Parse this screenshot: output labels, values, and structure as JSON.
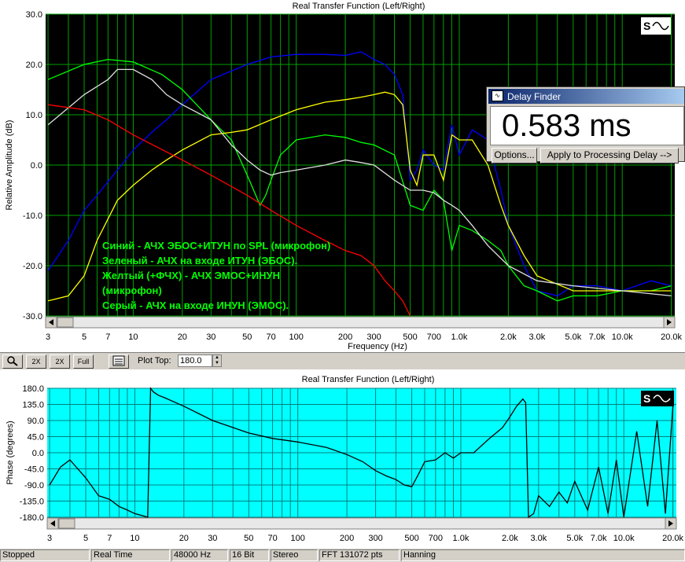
{
  "colors": {
    "magnitude_bg": "#000000",
    "phase_bg": "#00ffff",
    "grid_green": "#00a000",
    "phase_grid": "#008080",
    "annotation_text": "#00ff00",
    "series_blue": "#0000ff",
    "series_green": "#00ff00",
    "series_yellow": "#ffff00",
    "series_gray": "#e0e0e0",
    "series_red": "#ff0000"
  },
  "magnitude_chart": {
    "title": "Real Transfer Function (Left/Right)",
    "ylabel": "Relative Amplitude (dB)",
    "xlabel": "Frequency (Hz)",
    "y_ticks": [
      "30.0",
      "20.0",
      "10.0",
      "0.0",
      "-10.0",
      "-20.0",
      "-30.0"
    ],
    "x_ticks": [
      {
        "label": "3",
        "f": 3
      },
      {
        "label": "5",
        "f": 5
      },
      {
        "label": "7",
        "f": 7
      },
      {
        "label": "10",
        "f": 10
      },
      {
        "label": "20",
        "f": 20
      },
      {
        "label": "30",
        "f": 30
      },
      {
        "label": "50",
        "f": 50
      },
      {
        "label": "70",
        "f": 70
      },
      {
        "label": "100",
        "f": 100
      },
      {
        "label": "200",
        "f": 200
      },
      {
        "label": "300",
        "f": 300
      },
      {
        "label": "500",
        "f": 500
      },
      {
        "label": "700",
        "f": 700
      },
      {
        "label": "1.0k",
        "f": 1000
      },
      {
        "label": "2.0k",
        "f": 2000
      },
      {
        "label": "3.0k",
        "f": 3000
      },
      {
        "label": "5.0k",
        "f": 5000
      },
      {
        "label": "7.0k",
        "f": 7000
      },
      {
        "label": "10.0k",
        "f": 10000
      },
      {
        "label": "20.0k",
        "f": 20000
      }
    ],
    "annotation_lines": [
      "Синий - АЧХ ЭБОС+ИТУН по SPL (микрофон)",
      "Зеленый - АЧХ на входе ИТУН (ЭБОС).",
      "Желтый (+ФЧХ) - АЧХ ЭМОС+ИНУН",
      "(микрофон)",
      "Серый - АЧХ на входе ИНУН (ЭМОС)."
    ]
  },
  "phase_chart": {
    "title": "Real Transfer Function (Left/Right)",
    "ylabel": "Phase (degrees)",
    "xlabel": "Frequency (Hz)",
    "y_ticks": [
      "180.0",
      "135.0",
      "90.0",
      "45.0",
      "0.0",
      "-45.0",
      "-90.0",
      "-135.0",
      "-180.0"
    ],
    "x_ticks": [
      {
        "label": "3",
        "f": 3
      },
      {
        "label": "5",
        "f": 5
      },
      {
        "label": "7",
        "f": 7
      },
      {
        "label": "10",
        "f": 10
      },
      {
        "label": "20",
        "f": 20
      },
      {
        "label": "30",
        "f": 30
      },
      {
        "label": "50",
        "f": 50
      },
      {
        "label": "70",
        "f": 70
      },
      {
        "label": "100",
        "f": 100
      },
      {
        "label": "200",
        "f": 200
      },
      {
        "label": "300",
        "f": 300
      },
      {
        "label": "500",
        "f": 500
      },
      {
        "label": "700",
        "f": 700
      },
      {
        "label": "1.0k",
        "f": 1000
      },
      {
        "label": "2.0k",
        "f": 2000
      },
      {
        "label": "3.0k",
        "f": 3000
      },
      {
        "label": "5.0k",
        "f": 5000
      },
      {
        "label": "7.0k",
        "f": 7000
      },
      {
        "label": "10.0k",
        "f": 10000
      },
      {
        "label": "20.0k",
        "f": 20000
      }
    ]
  },
  "chart_data": [
    {
      "type": "line",
      "title": "Real Transfer Function (Left/Right)",
      "xlabel": "Frequency (Hz)",
      "ylabel": "Relative Amplitude (dB)",
      "x_scale": "log",
      "xlim": [
        2.9,
        21000
      ],
      "ylim": [
        -30,
        30
      ],
      "grid": true,
      "legend": "none",
      "series": [
        {
          "color": "#0000ff",
          "x": [
            3,
            4,
            5,
            6,
            8,
            10,
            13,
            16,
            20,
            30,
            50,
            70,
            100,
            150,
            200,
            250,
            300,
            350,
            400,
            450,
            500,
            550,
            600,
            700,
            800,
            900,
            1000,
            1200,
            1500,
            1800,
            2000,
            2500,
            3000,
            4000,
            5000,
            7000,
            10000,
            15000,
            20000
          ],
          "y": [
            -21,
            -15,
            -9,
            -6,
            -1,
            3,
            6.5,
            9,
            12,
            17,
            20,
            21.5,
            22,
            22,
            21.8,
            22.5,
            21,
            20,
            18,
            14,
            -3,
            -1,
            3,
            0,
            -1,
            8,
            2,
            7,
            5,
            -5,
            -12,
            -20,
            -25,
            -26,
            -24,
            -24,
            -25,
            -23,
            -24
          ]
        },
        {
          "color": "#00ff00",
          "x": [
            3,
            5,
            7,
            10,
            15,
            20,
            30,
            40,
            50,
            60,
            65,
            70,
            80,
            100,
            150,
            200,
            250,
            300,
            400,
            500,
            600,
            700,
            800,
            900,
            1000,
            1200,
            1500,
            1800,
            2000,
            2500,
            3000,
            4000,
            5000,
            7000,
            10000,
            15000,
            20000
          ],
          "y": [
            17,
            20,
            21,
            20.5,
            18,
            15,
            9,
            5,
            -2,
            -8,
            -6,
            -3,
            2,
            5,
            6,
            5.5,
            4.5,
            4,
            2,
            -8,
            -9,
            -5,
            -7,
            -17,
            -12,
            -13,
            -15,
            -17,
            -20,
            -24,
            -25,
            -27,
            -26,
            -26,
            -25,
            -25,
            -24
          ]
        },
        {
          "color": "#ffff00",
          "x": [
            3,
            4,
            5,
            6,
            8,
            10,
            13,
            16,
            20,
            30,
            40,
            50,
            70,
            100,
            150,
            200,
            250,
            300,
            350,
            400,
            450,
            500,
            550,
            600,
            700,
            800,
            900,
            1000,
            1200,
            1500,
            1800,
            2000,
            2500,
            3000,
            5000,
            10000,
            15000,
            20000
          ],
          "y": [
            -27,
            -26,
            -22,
            -15,
            -7,
            -4,
            -1,
            1,
            3,
            6,
            6.5,
            7,
            9,
            11,
            12.5,
            13,
            13.5,
            14,
            14.5,
            14,
            12,
            -1,
            -4,
            2,
            2,
            -3,
            6,
            5,
            5,
            0,
            -8,
            -12,
            -18,
            -22,
            -25,
            -25,
            -25,
            -25
          ]
        },
        {
          "color": "#e0e0e0",
          "x": [
            3,
            5,
            7,
            8,
            10,
            13,
            16,
            20,
            30,
            40,
            50,
            60,
            70,
            80,
            100,
            150,
            200,
            250,
            300,
            400,
            500,
            600,
            700,
            800,
            900,
            1000,
            1200,
            1500,
            2000,
            3000,
            5000,
            10000,
            20000
          ],
          "y": [
            8,
            14,
            17,
            19,
            19,
            17,
            14,
            12,
            9,
            4,
            1,
            -1,
            -2,
            -1.5,
            -1,
            0,
            1,
            0.5,
            0,
            -3,
            -5,
            -5,
            -5.5,
            -7,
            -8,
            -9,
            -12,
            -16,
            -20,
            -23,
            -24,
            -25,
            -26
          ]
        },
        {
          "color": "#ff0000",
          "x": [
            3,
            5,
            7,
            10,
            20,
            30,
            50,
            70,
            100,
            150,
            200,
            250,
            300,
            350,
            400,
            450,
            500
          ],
          "y": [
            12,
            11,
            9,
            6,
            1,
            -2,
            -6,
            -9,
            -12,
            -15,
            -17,
            -18,
            -20,
            -23,
            -25,
            -27,
            -30
          ]
        }
      ]
    },
    {
      "type": "line",
      "title": "Real Transfer Function (Left/Right)",
      "xlabel": "Frequency (Hz)",
      "ylabel": "Phase (degrees)",
      "x_scale": "log",
      "xlim": [
        2.9,
        21000
      ],
      "ylim": [
        -180,
        180
      ],
      "grid": true,
      "series": [
        {
          "color": "#000000",
          "x": [
            3,
            3.5,
            4,
            5,
            6,
            7,
            8,
            9,
            10,
            11,
            12,
            12.5,
            13,
            14,
            15,
            20,
            30,
            50,
            70,
            100,
            150,
            200,
            250,
            300,
            350,
            400,
            450,
            500,
            550,
            600,
            700,
            800,
            900,
            1000,
            1200,
            1500,
            1800,
            2000,
            2200,
            2400,
            2500,
            2600,
            2800,
            3000,
            3500,
            4000,
            4500,
            5000,
            6000,
            7000,
            8000,
            9000,
            10000,
            12000,
            14000,
            16000,
            18000,
            20000
          ],
          "y": [
            -90,
            -40,
            -20,
            -70,
            -120,
            -130,
            -150,
            -160,
            -170,
            -175,
            -180,
            180,
            170,
            160,
            155,
            130,
            90,
            55,
            40,
            30,
            15,
            -5,
            -25,
            -50,
            -65,
            -75,
            -90,
            -95,
            -60,
            -25,
            -20,
            0,
            -15,
            0,
            0,
            40,
            70,
            100,
            130,
            150,
            140,
            -180,
            -170,
            -120,
            -150,
            -110,
            -140,
            -80,
            -160,
            -40,
            -170,
            -20,
            -180,
            60,
            -150,
            90,
            -170,
            130
          ]
        }
      ]
    }
  ],
  "toolbar": {
    "plot_top_label": "Plot Top:",
    "plot_top_value": "180.0",
    "zoom_icon": "magnifier-icon",
    "btn_2x_in": "2X",
    "btn_2x_out": "2X",
    "btn_full": "Full",
    "spin_up": "▲",
    "spin_down": "▼"
  },
  "delay_finder": {
    "title": "Delay Finder",
    "value": "0.583 ms",
    "options_label": "Options...",
    "apply_label": "Apply to Processing Delay -->"
  },
  "status_bar": {
    "state": "Stopped",
    "mode": "Real Time",
    "sample_rate": "48000 Hz",
    "bit_depth": "16 Bit",
    "channels": "Stereo",
    "fft": "FFT 131072 pts",
    "window": "Hanning"
  }
}
